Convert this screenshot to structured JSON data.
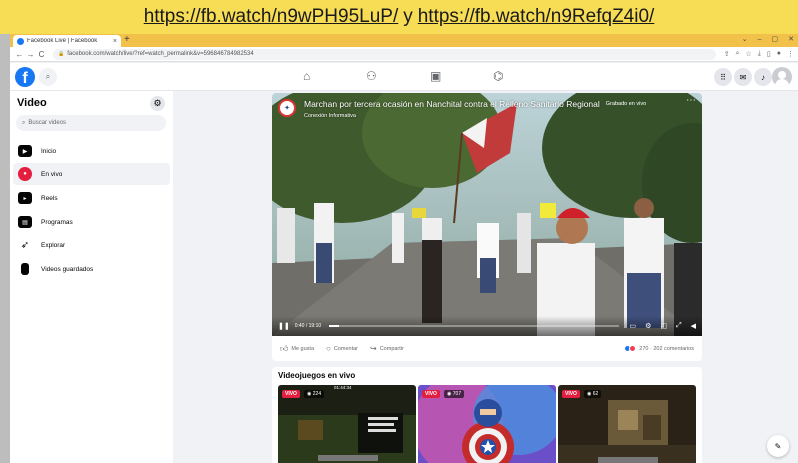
{
  "banner": {
    "link1": "https://fb.watch/n9wPH95LuP/",
    "separator": "y",
    "link2": "https://fb.watch/n9RefqZ4i0/"
  },
  "browser": {
    "tab_title": "Facebook Live | Facebook",
    "tab_close": "×",
    "new_tab": "+",
    "url": "facebook.com/watch/live/?ref=watch_permalink&v=596846784982534",
    "controls": {
      "minimize": "–",
      "maximize": "▢",
      "close": "✕",
      "collapse": "⌄"
    },
    "nav": {
      "back": "←",
      "forward": "→",
      "reload": "C"
    }
  },
  "fb": {
    "logo": "f",
    "nav_icons": [
      "home-icon",
      "friends-icon",
      "marketplace-icon",
      "gaming-icon"
    ],
    "right_icons": [
      "menu-grid-icon",
      "messenger-icon",
      "bell-icon",
      "avatar"
    ]
  },
  "sidebar": {
    "title": "Video",
    "search_placeholder": "Buscar videos",
    "items": [
      {
        "label": "Inicio",
        "icon": "play-screen-icon",
        "active": false
      },
      {
        "label": "En vivo",
        "icon": "live-camera-icon",
        "active": true
      },
      {
        "label": "Reels",
        "icon": "reels-icon",
        "active": false
      },
      {
        "label": "Programas",
        "icon": "shows-icon",
        "active": false
      },
      {
        "label": "Explorar",
        "icon": "explore-rocket-icon",
        "active": false
      },
      {
        "label": "Videos guardados",
        "icon": "bookmark-icon",
        "active": false
      }
    ]
  },
  "video": {
    "title": "Marchan por tercera ocasión en Nanchital contra el Relleno Sanitario Regional",
    "channel": "Conexión Informativa",
    "status": "Grabado en vivo",
    "time": "0:40 / 19:10",
    "progress": 0.035,
    "actions": {
      "like": "Me gusta",
      "comment": "Comentar",
      "share": "Compartir"
    },
    "reactions": "270 · 202 comentarios"
  },
  "live_games": {
    "title": "Videojuegos en vivo",
    "streams": [
      {
        "badge": "VIVO",
        "viewers": "224",
        "timer": "01:44:34"
      },
      {
        "badge": "VIVO",
        "viewers": "707"
      },
      {
        "badge": "VIVO",
        "viewers": "62"
      }
    ]
  },
  "colors": {
    "fb_blue": "#1877f2",
    "live_red": "#e41e3f",
    "banner_yellow": "#f7dd55",
    "tab_strip": "#f2c14a"
  }
}
